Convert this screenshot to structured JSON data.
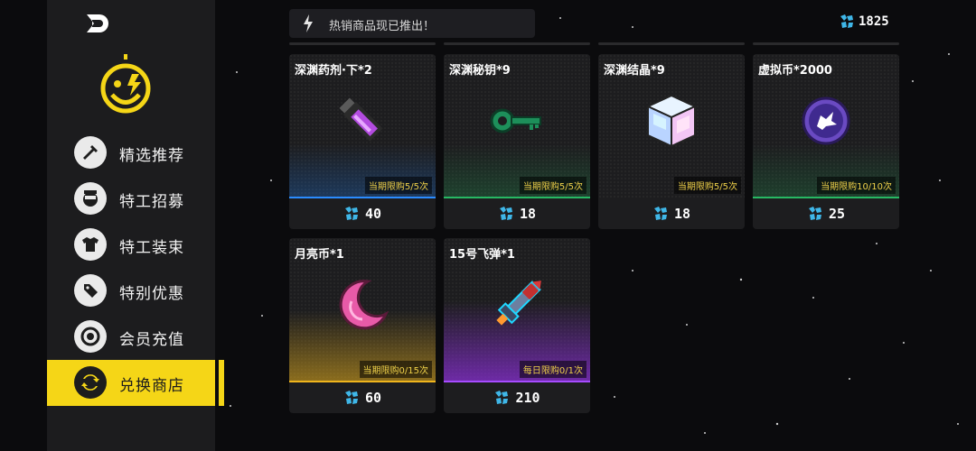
{
  "notice": {
    "text": "热销商品现已推出！",
    "icon": "lightning-icon"
  },
  "currency": {
    "amount": "1825",
    "icon": "crystal-icon"
  },
  "sidebar": {
    "items": [
      {
        "label": "精选推荐",
        "icon": "wrench-icon",
        "active": false
      },
      {
        "label": "特工招募",
        "icon": "agent-icon",
        "active": false
      },
      {
        "label": "特工装束",
        "icon": "shirt-icon",
        "active": false
      },
      {
        "label": "特别优惠",
        "icon": "tag-icon",
        "active": false
      },
      {
        "label": "会员充值",
        "icon": "target-icon",
        "active": false
      },
      {
        "label": "兑换商店",
        "icon": "exchange-icon",
        "active": true
      }
    ]
  },
  "shop": {
    "items": [
      {
        "title": "深渊药剂·下*2",
        "limit": "当期限购5/5次",
        "price": "40",
        "icon": "potion-icon",
        "accent": "#1e6fd1"
      },
      {
        "title": "深渊秘钥*9",
        "limit": "当期限购5/5次",
        "price": "18",
        "icon": "key-icon",
        "accent": "#1f9a52"
      },
      {
        "title": "深渊结晶*9",
        "limit": "当期限购5/5次",
        "price": "18",
        "icon": "crystal-cube-icon",
        "accent": "#777777"
      },
      {
        "title": "虚拟币*2000",
        "limit": "当期限购10/10次",
        "price": "25",
        "icon": "virtual-coin-icon",
        "accent": "#1f9a52"
      },
      {
        "title": "月亮币*1",
        "limit": "当期限购0/15次",
        "price": "60",
        "icon": "moon-coin-icon",
        "accent": "#d8a51c"
      },
      {
        "title": "15号飞弹*1",
        "limit": "每日限购0/1次",
        "price": "210",
        "icon": "missile-icon",
        "accent": "#8a2fd6"
      }
    ]
  }
}
